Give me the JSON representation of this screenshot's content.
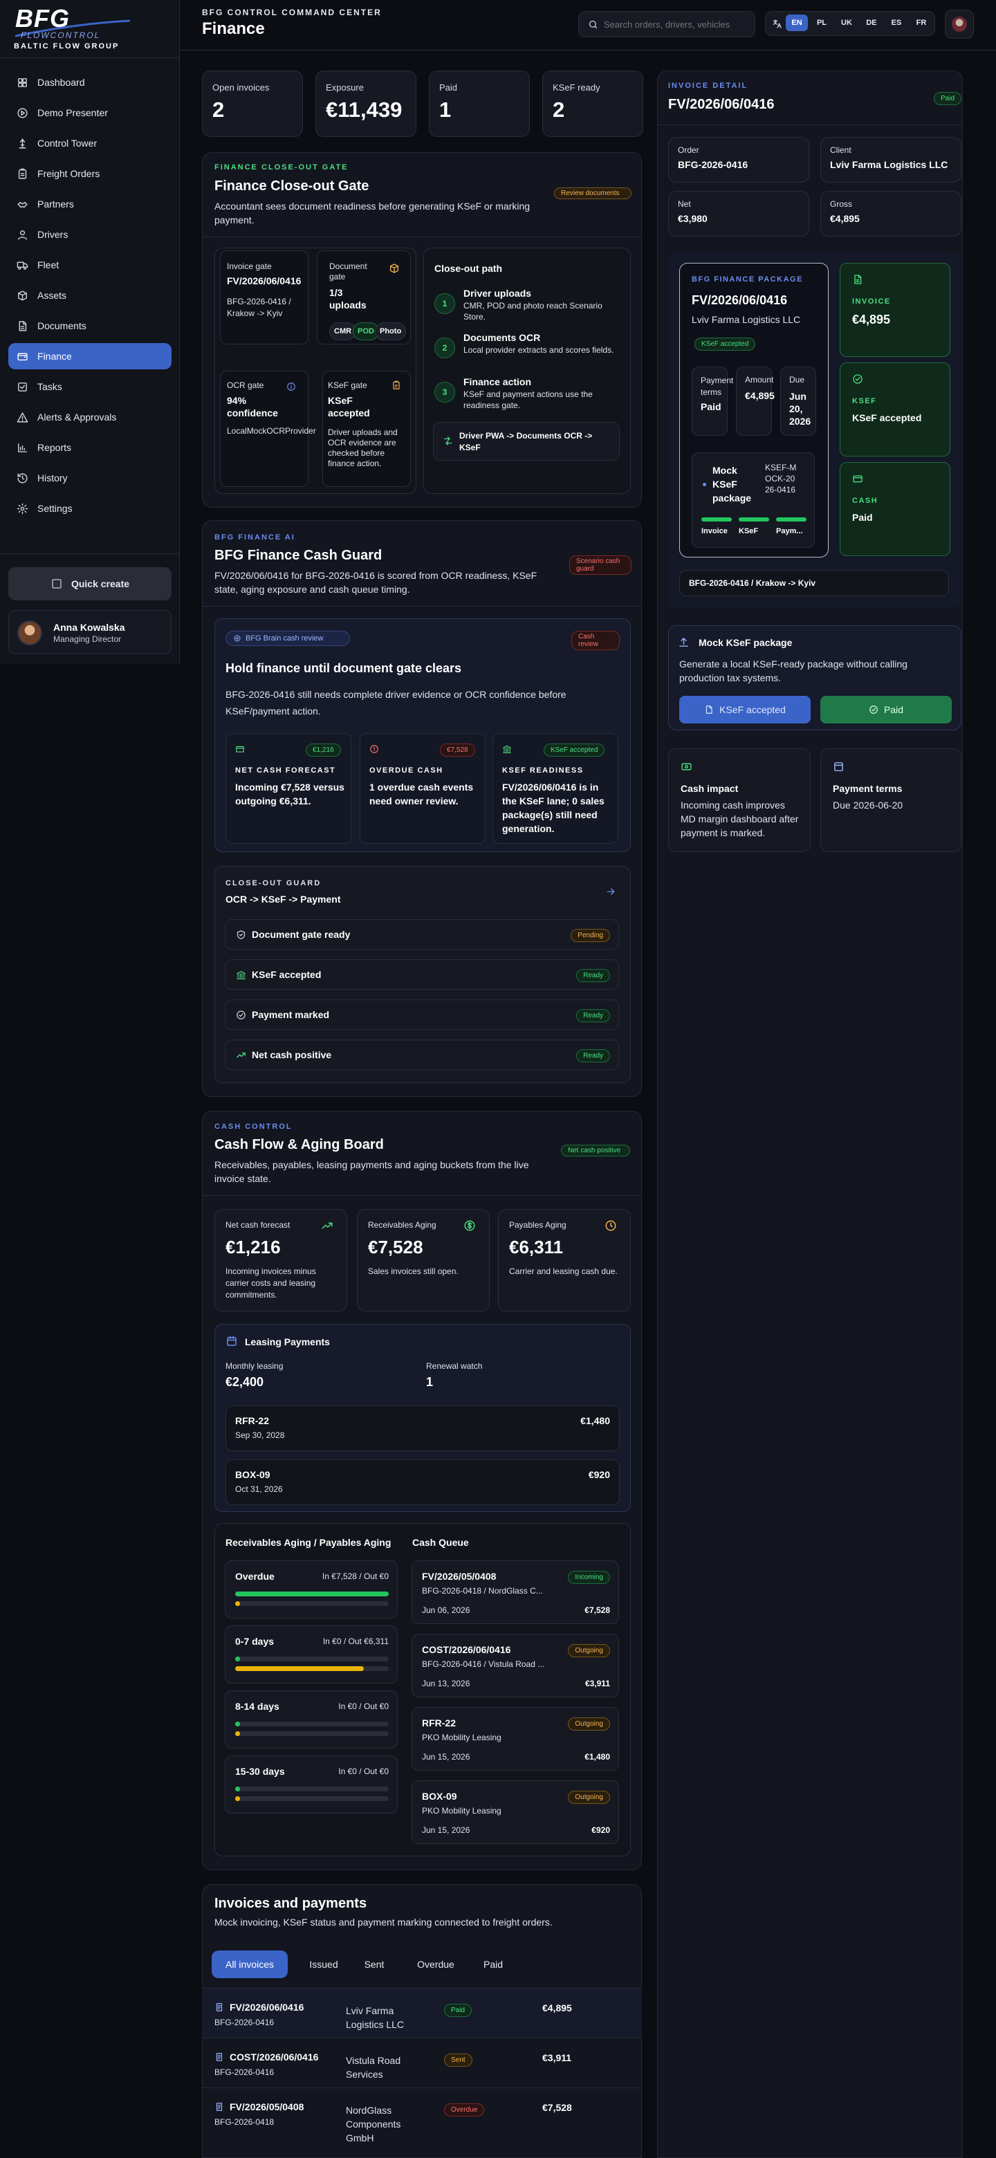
{
  "brand": {
    "name": "BFG",
    "sub": "FLOWCONTROL",
    "company": "BALTIC FLOW GROUP"
  },
  "header": {
    "eyebrow": "BFG CONTROL COMMAND CENTER",
    "title": "Finance",
    "search_placeholder": "Search orders, drivers, vehicles",
    "languages": [
      "EN",
      "PL",
      "UK",
      "DE",
      "ES",
      "FR"
    ],
    "active_language": "EN"
  },
  "sidebar": {
    "items": [
      {
        "label": "Dashboard",
        "icon": "dashboard-icon"
      },
      {
        "label": "Demo Presenter",
        "icon": "play-circle-icon"
      },
      {
        "label": "Control Tower",
        "icon": "tower-icon"
      },
      {
        "label": "Freight Orders",
        "icon": "clipboard-icon"
      },
      {
        "label": "Partners",
        "icon": "handshake-icon"
      },
      {
        "label": "Drivers",
        "icon": "user-icon"
      },
      {
        "label": "Fleet",
        "icon": "truck-icon"
      },
      {
        "label": "Assets",
        "icon": "box-icon"
      },
      {
        "label": "Documents",
        "icon": "document-icon"
      },
      {
        "label": "Finance",
        "icon": "wallet-icon",
        "active": true
      },
      {
        "label": "Tasks",
        "icon": "check-square-icon"
      },
      {
        "label": "Alerts & Approvals",
        "icon": "alert-icon"
      },
      {
        "label": "Reports",
        "icon": "chart-icon"
      },
      {
        "label": "History",
        "icon": "history-icon"
      },
      {
        "label": "Settings",
        "icon": "gear-icon"
      }
    ],
    "quick_create": "Quick create",
    "user": {
      "name": "Anna Kowalska",
      "role": "Managing Director"
    }
  },
  "kpis": [
    {
      "label": "Open invoices",
      "value": "2"
    },
    {
      "label": "Exposure",
      "value": "€11,439"
    },
    {
      "label": "Paid",
      "value": "1"
    },
    {
      "label": "KSeF ready",
      "value": "2"
    }
  ],
  "closeout": {
    "eyebrow": "FINANCE CLOSE-OUT GATE",
    "title": "Finance Close-out Gate",
    "desc": "Accountant sees document readiness before generating KSeF or marking payment.",
    "badge": "Review documents",
    "invoice_gate": {
      "label": "Invoice gate",
      "value": "FV/2026/06/0416",
      "detail": "BFG-2026-0416 / Krakow -> Kyiv"
    },
    "document_gate": {
      "label": "Document gate",
      "value": "1/3 uploads",
      "chips": [
        "CMR",
        "POD",
        "Photo"
      ]
    },
    "ocr_gate": {
      "label": "OCR gate",
      "value": "94% confidence",
      "detail": "LocalMockOCRProvider"
    },
    "ksef_gate": {
      "label": "KSeF gate",
      "value": "KSeF accepted",
      "detail": "Driver uploads and OCR evidence are checked before finance action."
    },
    "path": {
      "title": "Close-out path",
      "steps": [
        {
          "n": "1",
          "t": "Driver uploads",
          "d": "CMR, POD and photo reach Scenario Store."
        },
        {
          "n": "2",
          "t": "Documents OCR",
          "d": "Local provider extracts and scores fields."
        },
        {
          "n": "3",
          "t": "Finance action",
          "d": "KSeF and payment actions use the readiness gate."
        }
      ],
      "flow": "Driver PWA -> Documents OCR -> KSeF"
    }
  },
  "ai": {
    "eyebrow": "BFG FINANCE AI",
    "title": "BFG Finance Cash Guard",
    "desc": "FV/2026/06/0416 for BFG-2026-0416 is scored from OCR readiness, KSeF state, aging exposure and cash queue timing.",
    "badge": "Scenario cash guard",
    "review_chip": "BFG Brain cash review",
    "review_badge": "Cash review",
    "headline": "Hold finance until document gate clears",
    "body": "BFG-2026-0416 still needs complete driver evidence or OCR confidence before KSeF/payment action.",
    "cards": [
      {
        "badge": "€1,216",
        "label": "NET CASH FORECAST",
        "text": "Incoming €7,528 versus outgoing €6,311."
      },
      {
        "badge": "€7,528",
        "label": "OVERDUE CASH",
        "text": "1 overdue cash events need owner review."
      },
      {
        "badge": "KSeF accepted",
        "label": "KSEF READINESS",
        "text": "FV/2026/06/0416 is in the KSeF lane; 0 sales package(s) still need generation."
      }
    ],
    "guard": {
      "eyebrow": "CLOSE-OUT GUARD",
      "title": "OCR -> KSeF -> Payment",
      "rows": [
        {
          "t": "Document gate ready",
          "s": "Pending"
        },
        {
          "t": "KSeF accepted",
          "s": "Ready"
        },
        {
          "t": "Payment marked",
          "s": "Ready"
        },
        {
          "t": "Net cash positive",
          "s": "Ready"
        }
      ]
    }
  },
  "cash": {
    "eyebrow": "CASH CONTROL",
    "title": "Cash Flow & Aging Board",
    "desc": "Receivables, payables, leasing payments and aging buckets from the live invoice state.",
    "badge": "Net cash positive",
    "stats": [
      {
        "l": "Net cash forecast",
        "v": "€1,216",
        "d": "Incoming invoices minus carrier costs and leasing commitments."
      },
      {
        "l": "Receivables Aging",
        "v": "€7,528",
        "d": "Sales invoices still open."
      },
      {
        "l": "Payables Aging",
        "v": "€6,311",
        "d": "Carrier and leasing cash due."
      }
    ],
    "leasing": {
      "title": "Leasing Payments",
      "monthly_label": "Monthly leasing",
      "monthly": "€2,400",
      "renewal_label": "Renewal watch",
      "renewal": "1",
      "items": [
        {
          "n": "RFR-22",
          "d": "Sep 30, 2028",
          "a": "€1,480"
        },
        {
          "n": "BOX-09",
          "d": "Oct 31, 2026",
          "a": "€920"
        }
      ]
    },
    "aging_title": "Receivables Aging / Payables Aging",
    "aging": [
      {
        "b": "Overdue",
        "r": "In €7,528 / Out €0",
        "in": 1.0,
        "out": 0.03
      },
      {
        "b": "0-7 days",
        "r": "In €0 / Out €6,311",
        "in": 0.03,
        "out": 0.84
      },
      {
        "b": "8-14 days",
        "r": "In €0 / Out €0",
        "in": 0.03,
        "out": 0.03
      },
      {
        "b": "15-30 days",
        "r": "In €0 / Out €0",
        "in": 0.03,
        "out": 0.03
      }
    ],
    "queue_title": "Cash Queue",
    "queue": [
      {
        "n": "FV/2026/05/0408",
        "s": "Incoming",
        "d": "BFG-2026-0418 / NordGlass C...",
        "date": "Jun 06, 2026",
        "a": "€7,528"
      },
      {
        "n": "COST/2026/06/0416",
        "s": "Outgoing",
        "d": "BFG-2026-0416 / Vistula Road ...",
        "date": "Jun 13, 2026",
        "a": "€3,911"
      },
      {
        "n": "RFR-22",
        "s": "Outgoing",
        "d": "PKO Mobility Leasing",
        "date": "Jun 15, 2026",
        "a": "€1,480"
      },
      {
        "n": "BOX-09",
        "s": "Outgoing",
        "d": "PKO Mobility Leasing",
        "date": "Jun 15, 2026",
        "a": "€920"
      }
    ]
  },
  "invoices": {
    "title": "Invoices and payments",
    "desc": "Mock invoicing, KSeF status and payment marking connected to freight orders.",
    "tabs": [
      "All invoices",
      "Issued",
      "Sent",
      "Overdue",
      "Paid"
    ],
    "rows": [
      {
        "n": "FV/2026/06/0416",
        "o": "BFG-2026-0416",
        "c": "Lviv Farma Logistics LLC",
        "s": "Paid",
        "a": "€4,895"
      },
      {
        "n": "COST/2026/06/0416",
        "o": "BFG-2026-0416",
        "c": "Vistula Road Services",
        "s": "Sent",
        "a": "€3,911"
      },
      {
        "n": "FV/2026/05/0408",
        "o": "BFG-2026-0418",
        "c": "NordGlass Components GmbH",
        "s": "Overdue",
        "a": "€7,528"
      }
    ]
  },
  "detail": {
    "eyebrow": "INVOICE DETAIL",
    "title": "FV/2026/06/0416",
    "badge": "Paid",
    "fields": [
      {
        "l": "Order",
        "v": "BFG-2026-0416"
      },
      {
        "l": "Client",
        "v": "Lviv Farma Logistics LLC"
      },
      {
        "l": "Net",
        "v": "€3,980"
      },
      {
        "l": "Gross",
        "v": "€4,895"
      }
    ],
    "package": {
      "eyebrow": "BFG FINANCE PACKAGE",
      "title": "FV/2026/06/0416",
      "client": "Lviv Farma Logistics LLC",
      "badge": "KSeF accepted",
      "terms_l": "Payment terms",
      "terms_v": "Paid",
      "amount_l": "Amount",
      "amount_v": "€4,895",
      "due_l": "Due",
      "due_v": "Jun 20, 2026",
      "mock_title": "Mock KSeF package",
      "mock_id": "KSEF-MOCK-2026-0416",
      "progress": [
        "Invoice",
        "KSeF",
        "Paym..."
      ]
    },
    "side": [
      {
        "l": "INVOICE",
        "v": "€4,895"
      },
      {
        "l": "KSEF",
        "v": "KSeF accepted"
      },
      {
        "l": "CASH",
        "v": "Paid"
      }
    ],
    "route": "BFG-2026-0416 / Krakow -> Kyiv",
    "mock": {
      "title": "Mock KSeF package",
      "desc": "Generate a local KSeF-ready package without calling production tax systems.",
      "btn1": "KSeF accepted",
      "btn2": "Paid"
    },
    "impact": {
      "title": "Cash impact",
      "text": "Incoming cash improves MD margin dashboard after payment is marked."
    },
    "terms": {
      "title": "Payment terms",
      "text": "Due 2026-06-20"
    }
  }
}
